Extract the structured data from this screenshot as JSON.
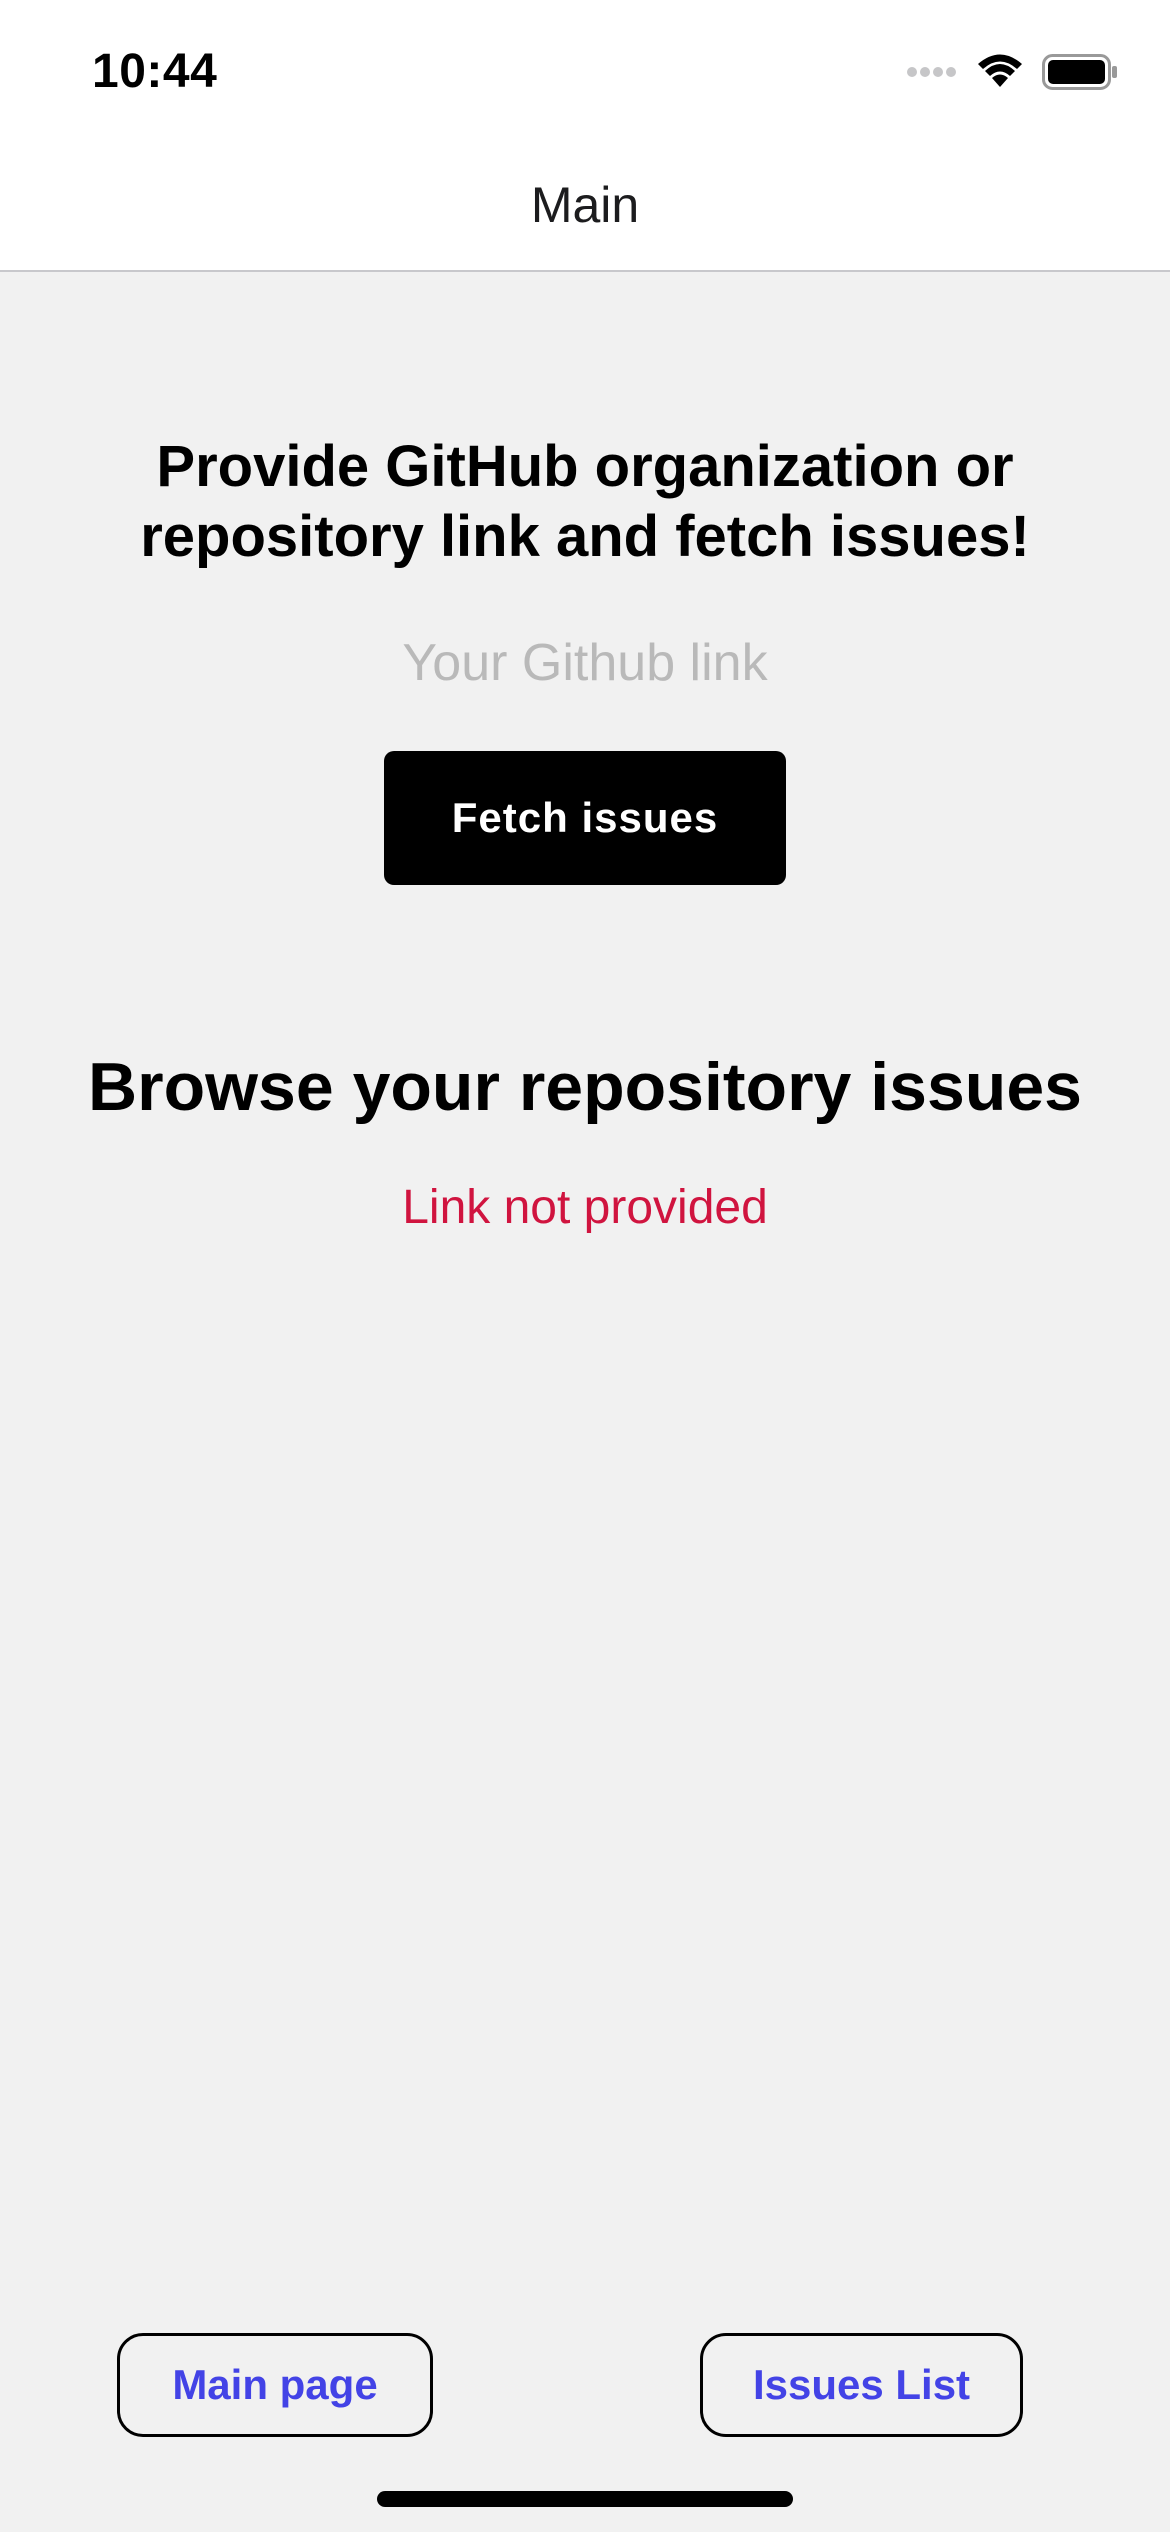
{
  "status_bar": {
    "time": "10:44",
    "icons": [
      "cellular-signal-icon",
      "wifi-icon",
      "battery-icon"
    ]
  },
  "nav": {
    "title": "Main"
  },
  "main": {
    "prompt_heading": "Provide GitHub organization or repository link and fetch issues!",
    "link_input": {
      "value": "",
      "placeholder": "Your Github link"
    },
    "fetch_button_label": "Fetch issues",
    "browse_heading": "Browse your repository issues",
    "error_text": "Link not provided"
  },
  "bottom_nav": {
    "main_page_label": "Main page",
    "issues_list_label": "Issues List"
  },
  "colors": {
    "background": "#f1f1f1",
    "error": "#d0143f",
    "link_button_text": "#4343e6",
    "primary_button": "#000000"
  }
}
